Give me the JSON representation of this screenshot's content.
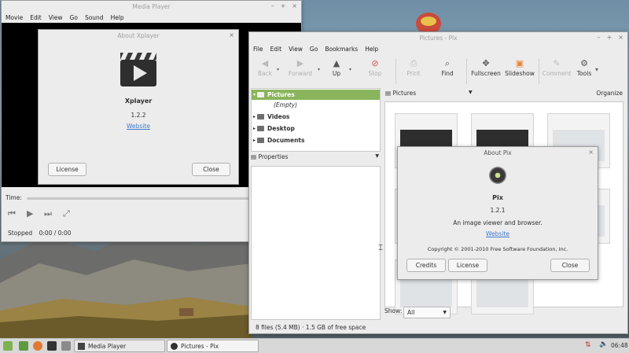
{
  "media_player": {
    "title": "Media Player",
    "menu": [
      "Movie",
      "Edit",
      "View",
      "Go",
      "Sound",
      "Help"
    ],
    "time_label": "Time:",
    "status": "Stopped",
    "position": "0:00 / 0:00"
  },
  "about_xplayer": {
    "title": "About Xplayer",
    "app_name": "Xplayer",
    "version": "1.2.2",
    "website": "Website",
    "license_btn": "License",
    "close_btn": "Close"
  },
  "pix": {
    "title": "Pictures - Pix",
    "menu": [
      "File",
      "Edit",
      "View",
      "Go",
      "Bookmarks",
      "Help"
    ],
    "toolbar": {
      "back": "Back",
      "forward": "Forward",
      "up": "Up",
      "stop": "Stop",
      "print": "Print",
      "find": "Find",
      "fullscreen": "Fullscreen",
      "slideshow": "Slideshow",
      "comment": "Comment",
      "tools": "Tools"
    },
    "tree": {
      "pictures": "Pictures",
      "empty": "(Empty)",
      "videos": "Videos",
      "desktop": "Desktop",
      "documents": "Documents"
    },
    "properties": "Properties",
    "location": "Pictures",
    "organize": "Organize",
    "show_label": "Show:",
    "show_value": "All",
    "status": "8 files (5.4 MB) · 1.5 GB of free space"
  },
  "about_pix": {
    "title": "About Pix",
    "app_name": "Pix",
    "version": "1.2.1",
    "description": "An image viewer and browser.",
    "website": "Website",
    "copyright": "Copyright © 2001-2010 Free Software Foundation, Inc.",
    "credits_btn": "Credits",
    "license_btn": "License",
    "close_btn": "Close"
  },
  "taskbar": {
    "task_media": "Media Player",
    "task_pix": "Pictures - Pix",
    "clock": "06:48"
  },
  "colors": {
    "accent": "#8ab55c",
    "link": "#3e7bd0"
  }
}
